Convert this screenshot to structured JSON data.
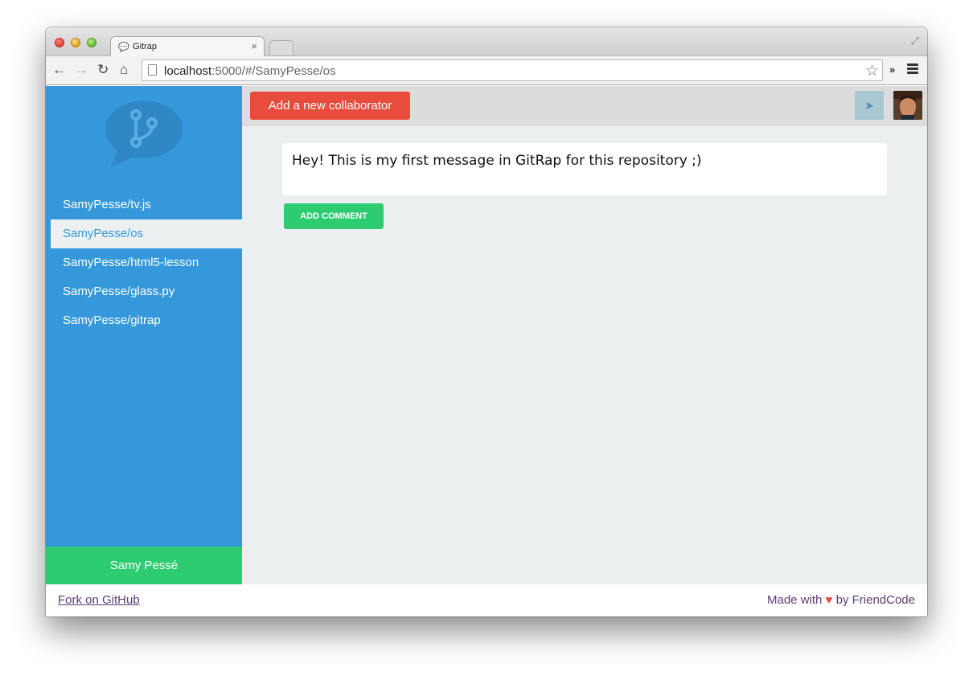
{
  "browser": {
    "tab_title": "Gitrap",
    "url_host": "localhost",
    "url_rest": ":5000/#/SamyPesse/os"
  },
  "sidebar": {
    "repos": [
      {
        "label": "SamyPesse/tv.js",
        "active": false
      },
      {
        "label": "SamyPesse/os",
        "active": true
      },
      {
        "label": "SamyPesse/html5-lesson",
        "active": false
      },
      {
        "label": "SamyPesse/glass.py",
        "active": false
      },
      {
        "label": "SamyPesse/gitrap",
        "active": false
      }
    ],
    "user_name": "Samy Pessé"
  },
  "topbar": {
    "add_collaborator_label": "Add a new collaborator"
  },
  "main": {
    "message_text": "Hey! This is my first message in GitRap for this repository ;)",
    "add_comment_label": "ADD COMMENT"
  },
  "footer": {
    "fork_link": "Fork on GitHub",
    "made_with_prefix": "Made with",
    "made_with_suffix": "by FriendCode"
  },
  "colors": {
    "sidebar": "#3498db",
    "collaborator_button": "#e74c3c",
    "comment_button": "#2ecc71",
    "user_footer": "#2ecc71"
  }
}
